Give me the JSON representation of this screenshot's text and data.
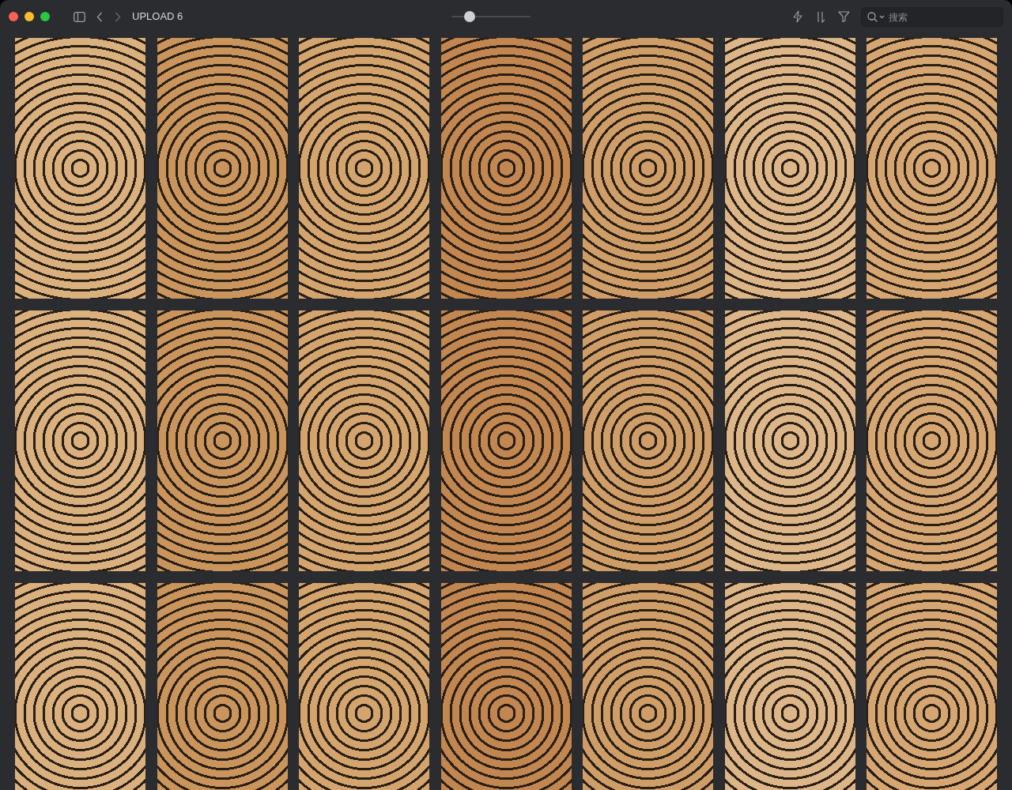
{
  "window": {
    "title": "UPLOAD 6"
  },
  "toolbar": {
    "zoom_slider": {
      "level": 0.18
    },
    "search": {
      "placeholder": "搜索"
    }
  },
  "grid": {
    "tiles": [
      {
        "kind": "image"
      },
      {
        "kind": "image"
      },
      {
        "kind": "image"
      },
      {
        "kind": "image"
      },
      {
        "kind": "image"
      },
      {
        "kind": "image"
      },
      {
        "kind": "image"
      },
      {
        "kind": "image"
      },
      {
        "kind": "image"
      },
      {
        "kind": "image"
      },
      {
        "kind": "image"
      },
      {
        "kind": "image"
      },
      {
        "kind": "image"
      },
      {
        "kind": "image"
      },
      {
        "kind": "image"
      },
      {
        "kind": "image"
      },
      {
        "kind": "image"
      },
      {
        "kind": "image"
      },
      {
        "kind": "image"
      },
      {
        "kind": "image"
      },
      {
        "kind": "image"
      }
    ]
  }
}
